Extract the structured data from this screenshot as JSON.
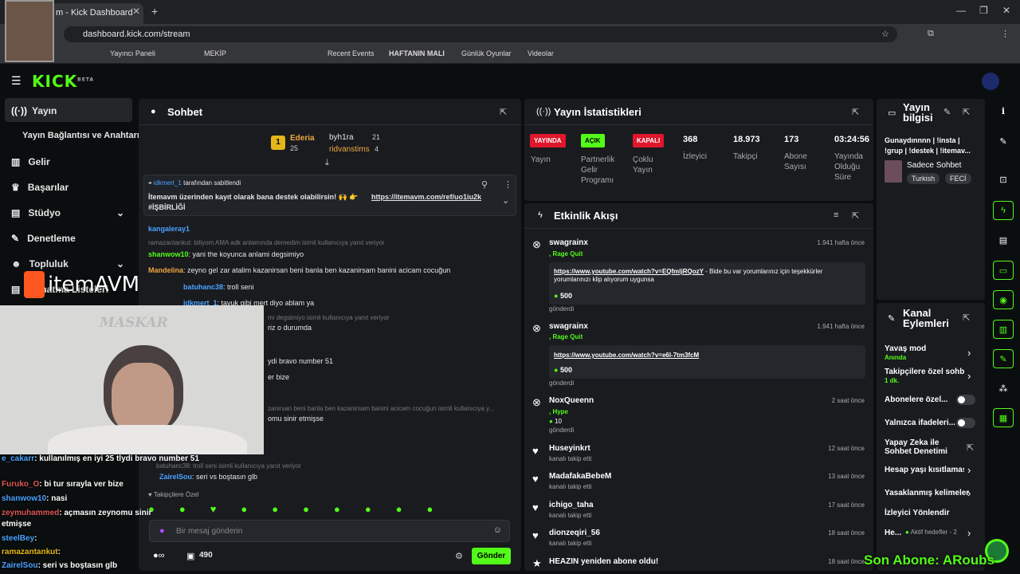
{
  "browser": {
    "tab_title": "m - Kick Dashboard",
    "url": "dashboard.kick.com/stream",
    "bookmarks": [
      "Yayıncı Paneli",
      "MEKİP",
      "Recent Events",
      "HAFTANIN MALI",
      "Günlük Oyunlar",
      "Videolar"
    ]
  },
  "app": {
    "logo": "KICK",
    "logo_sup": "BETA"
  },
  "sidebar": {
    "items": [
      {
        "label": "Yayın",
        "icon": "broadcast-icon"
      },
      {
        "label": "Yayın Bağlantısı ve Anahtarı"
      },
      {
        "label": "Gelir",
        "icon": "chart-icon"
      },
      {
        "label": "Başarılar",
        "icon": "trophy-icon"
      },
      {
        "label": "Stüdyo",
        "icon": "studio-icon"
      },
      {
        "label": "Denetleme",
        "icon": "wrench-icon"
      },
      {
        "label": "Topluluk",
        "icon": "people-icon"
      },
      {
        "label": "Oynatma Listeleri"
      }
    ]
  },
  "chat": {
    "title": "Sohbet",
    "leaderboard": [
      {
        "rank": "1",
        "name": "Ederia",
        "count": "25",
        "name2": "byh1ra",
        "count2": "21"
      },
      {
        "name": "ridvanstims",
        "count": "4"
      }
    ],
    "pinned": {
      "by": "idkmert_1",
      "by_suffix": "tarafından sabitlendi",
      "text": "İtemavm üzerinden kayıt olarak bana destek olabilirsin! 🙌 👉",
      "link": "https://itemavm.com/ref/uo1iu2k",
      "tag": "#İŞBİRLİĞİ"
    },
    "messages": [
      {
        "user": "kangaleray1",
        "text": ""
      },
      {
        "reply": "ramazantankut: biliyom AMA adk anlamında demedim isimli kullanıcıya yanıt veriyor"
      },
      {
        "user": "shanwow10",
        "text": "yani the koyunca anlami degsimiyo"
      },
      {
        "user": "Mandelina",
        "text": "zeyno gel zar atalim kazanirsan beni banla ben kazanirsam banini acicam cocuğun"
      },
      {
        "user": "batuhanc38",
        "text": "troll seni"
      },
      {
        "user": "idkmert_1",
        "text": "tavuk gibi mert diyo ablam ya"
      },
      {
        "reply": "mi degsimiyo isimli kullanıcıya yanıt veriyor"
      },
      {
        "text": "riz o durumda"
      },
      {
        "text": "ydi bravo number 51"
      },
      {
        "text": "er bize"
      },
      {
        "reply": "zanirsan beni banla ben kazanirsam banini acicam cocuğun isimli kullanıcıya y..."
      },
      {
        "text": "omu sinir etmişse"
      },
      {
        "reply": "batuhanc38: troll seni isimli kullanıcıya yanıt veriyor"
      },
      {
        "user": "ZairelSou",
        "text": "seri vs boştasın glb"
      }
    ],
    "followers_label": "Takipçilere Özel",
    "input_placeholder": "Bir mesaj gönderin",
    "points": "490",
    "send_label": "Gönder"
  },
  "stats": {
    "title": "Yayın İstatistikleri",
    "items": [
      {
        "badge": "YAYINDA",
        "label": "Yayın",
        "color": "#e0162b"
      },
      {
        "badge": "AÇIK",
        "label": "Partnerlik Gelir Programı",
        "color": "#53fc18"
      },
      {
        "badge": "KAPALI",
        "label": "Çoklu Yayın",
        "color": "#e0162b"
      },
      {
        "value": "368",
        "label": "İzleyici"
      },
      {
        "value": "18.973",
        "label": "Takipçi"
      },
      {
        "value": "173",
        "label": "Abone Sayısı"
      },
      {
        "value": "03:24:56",
        "label": "Yayında Olduğu Süre"
      }
    ]
  },
  "feed": {
    "title": "Etkinlik Akışı",
    "events": [
      {
        "name": "swagrainx",
        "sub": ", Rage Quit",
        "time": "1.941 hafta önce",
        "link": "https://www.youtube.com/watch?v=EQfmljRQozY",
        "note": " - Bide bu var yorumlarınız için teşekkürler yorumlarınızı klip alıyorum uygunsa",
        "amount": "500",
        "foot": "gönderdi"
      },
      {
        "name": "swagrainx",
        "sub": ", Rage Quit",
        "time": "1.941 hafta önce",
        "link": "https://www.youtube.com/watch?v=e6l-7tm3fcM",
        "amount": "500",
        "foot": "gönderdi"
      },
      {
        "name": "NoxQueenn",
        "sub": ", Hype",
        "time": "2 saat önce",
        "amount": "10",
        "foot": "gönderdi"
      },
      {
        "name": "Huseyinkrt",
        "sub": "kanalı takip etti",
        "time": "12 saat önce"
      },
      {
        "name": "MadafakaBebeM",
        "sub": "kanalı takip etti",
        "time": "13 saat önce"
      },
      {
        "name": "ichigo_taha",
        "sub": "kanalı takip etti",
        "time": "17 saat önce"
      },
      {
        "name": "dionzeqiri_56",
        "sub": "kanalı takip etti",
        "time": "18 saat önce"
      },
      {
        "name": "HEAZIN yeniden abone oldu!",
        "time": "18 saat önce"
      }
    ]
  },
  "info": {
    "title": "Yayın bilgisi",
    "stream_title": "Gunaydınnnn | !insta | !grup | !destek | !itemav...",
    "category": "Sadece Sohbet",
    "tags": [
      "Turkish",
      "FECİ"
    ]
  },
  "channel": {
    "title": "Kanal Eylemleri",
    "actions": [
      {
        "label": "Yavaş mod",
        "sub": "Anında"
      },
      {
        "label": "Takipçilere özel sohbe",
        "sub": "1 dk."
      },
      {
        "label": "Abonelere özel..."
      },
      {
        "label": "Yalnızca ifadeleri..."
      },
      {
        "label": "Yapay Zeka ile Sohbet Denetimi"
      },
      {
        "label": "Hesap yaşı kısıtlaması"
      },
      {
        "label": "Yasaklanmış kelimeler"
      },
      {
        "label": "İzleyici Yönlendir"
      },
      {
        "label": "He...",
        "sub": "Aktif hedefler - 2"
      }
    ]
  },
  "overlay": {
    "brand": "itemAVM",
    "watermark": "MASKAR",
    "ticker": "Son Abone: ARoubs",
    "chat": [
      {
        "user": "e_cakarr",
        "text": ": kullanılmış en iyi 25 tlydi bravo number 51"
      },
      {
        "user": "Furuko_O",
        "text": ": bi tur sırayla ver bize"
      },
      {
        "user": "shanwow10",
        "text": ": nasi"
      },
      {
        "user": "zeymuhammed",
        "text": ": açmasın zeynomu sinir etmişse"
      },
      {
        "user": "steelBey",
        "text": ":"
      },
      {
        "user": "ramazantankut",
        "text": ":"
      },
      {
        "user": "ZairelSou",
        "text": ": seri vs boştasın glb"
      }
    ]
  }
}
